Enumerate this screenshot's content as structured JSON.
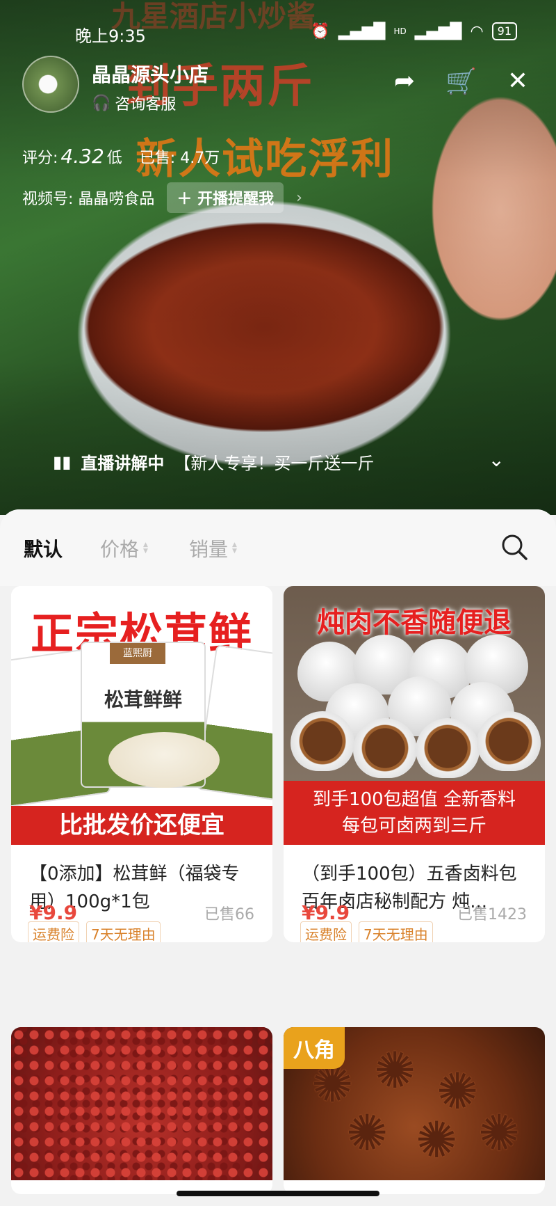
{
  "status_bar": {
    "time": "晚上9:35",
    "battery": "91",
    "network": "HD"
  },
  "hero": {
    "ad_top": "九星酒店小炒酱",
    "ad_main": "到手两斤",
    "ad_sub": "新人试吃浮利"
  },
  "shop": {
    "name": "晶晶源头小店",
    "consult_label": "咨询客服",
    "rating_label": "评分:",
    "rating_value": "4.32",
    "rating_level": "低",
    "sold_label": "已售:",
    "sold_value": "4.7万",
    "channel_label": "视频号: 晶晶唠食品",
    "remind_button": "开播提醒我"
  },
  "live": {
    "status": "直播讲解中",
    "promo": "【新人专享！买一斤送一斤"
  },
  "sort": {
    "default": "默认",
    "price": "价格",
    "sales": "销量"
  },
  "products": [
    {
      "title": "【0添加】松茸鲜（福袋专用）100g*1包",
      "tags": [
        "运费险",
        "7天无理由"
      ],
      "price": "¥9.9",
      "sold": "已售66",
      "image_headline": "正宗松茸鲜",
      "image_pack_label": "松茸鲜鲜",
      "image_pack_brand": "蓝熙厨",
      "image_footer": "比批发价还便宜"
    },
    {
      "title": "（到手100包）五香卤料包百年卤店秘制配方 炖...",
      "tags": [
        "运费险",
        "7天无理由"
      ],
      "price": "¥9.9",
      "sold": "已售1423",
      "image_headline": "炖肉不香随便退",
      "image_footer_line1": "到手100包超值  全新香料",
      "image_footer_line2": "每包可卤两到三斤"
    },
    {
      "image_badge": ""
    },
    {
      "image_badge": "八角"
    }
  ],
  "colors": {
    "accent": "#e8473c",
    "tag": "#d9822b",
    "promo_red": "#d6241f"
  }
}
